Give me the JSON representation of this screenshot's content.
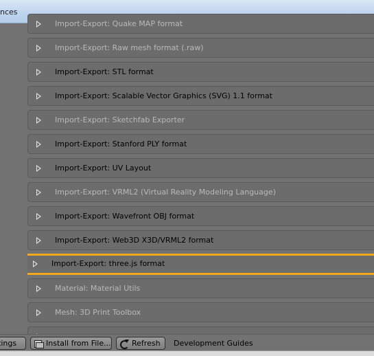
{
  "window": {
    "title": "nces"
  },
  "addons": [
    {
      "label": "Import-Export: Quake MAP format",
      "enabled": false
    },
    {
      "label": "Import-Export: Raw mesh format (.raw)",
      "enabled": false
    },
    {
      "label": "Import-Export: STL format",
      "enabled": true
    },
    {
      "label": "Import-Export: Scalable Vector Graphics (SVG) 1.1 format",
      "enabled": true
    },
    {
      "label": "Import-Export: Sketchfab Exporter",
      "enabled": false
    },
    {
      "label": "Import-Export: Stanford PLY format",
      "enabled": true
    },
    {
      "label": "Import-Export: UV Layout",
      "enabled": true
    },
    {
      "label": "Import-Export: VRML2 (Virtual Reality Modeling Language)",
      "enabled": false
    },
    {
      "label": "Import-Export: Wavefront OBJ format",
      "enabled": true
    },
    {
      "label": "Import-Export: Web3D X3D/VRML2 format",
      "enabled": true
    },
    {
      "label": "Import-Export: three.js format",
      "enabled": true,
      "selected": true
    },
    {
      "label": "Material: Material Utils",
      "enabled": false
    },
    {
      "label": "Mesh: 3D Print Toolbox",
      "enabled": false
    },
    {
      "label": "",
      "enabled": false
    }
  ],
  "toolbar": {
    "save_settings_label": "tings",
    "install_label": "Install from File...",
    "refresh_label": "Refresh",
    "dev_guides_label": "Development Guides"
  },
  "colors": {
    "selection_outline": "#f3a81c",
    "disabled_text": "#b9b9b9",
    "enabled_text": "#000000"
  }
}
